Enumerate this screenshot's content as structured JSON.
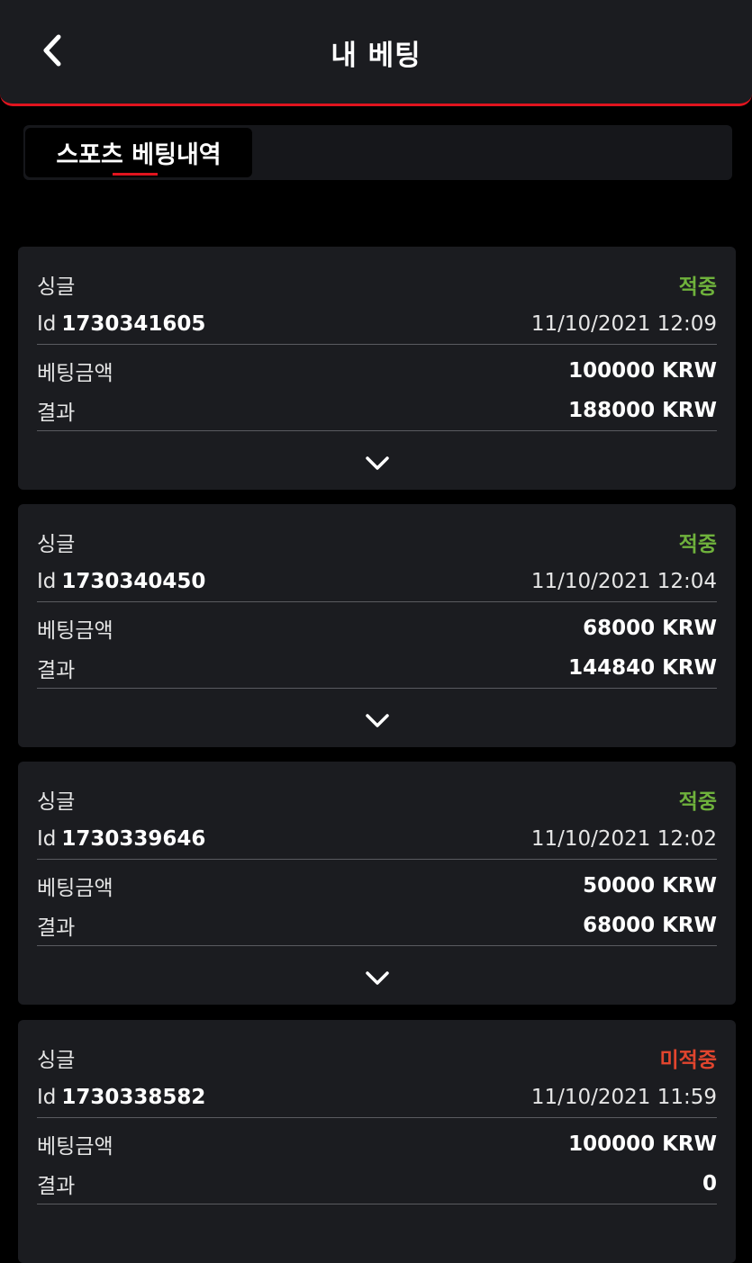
{
  "header": {
    "title": "내 베팅",
    "back_icon": "chevron-left-icon"
  },
  "tabs": [
    {
      "label": "스포츠 베팅내역",
      "active": true
    }
  ],
  "colors": {
    "accent": "#e0141e",
    "win": "#6fb23c",
    "lose": "#e2452e",
    "card": "#1b1c20"
  },
  "bets": [
    {
      "type": "싱글",
      "status": "적중",
      "status_kind": "win",
      "id_label": "Id",
      "id": "1730341605",
      "datetime": "11/10/2021 12:09",
      "stake_label": "베팅금액",
      "stake": "100000 KRW",
      "result_label": "결과",
      "result": "188000 KRW"
    },
    {
      "type": "싱글",
      "status": "적중",
      "status_kind": "win",
      "id_label": "Id",
      "id": "1730340450",
      "datetime": "11/10/2021 12:04",
      "stake_label": "베팅금액",
      "stake": "68000 KRW",
      "result_label": "결과",
      "result": "144840 KRW"
    },
    {
      "type": "싱글",
      "status": "적중",
      "status_kind": "win",
      "id_label": "Id",
      "id": "1730339646",
      "datetime": "11/10/2021 12:02",
      "stake_label": "베팅금액",
      "stake": "50000 KRW",
      "result_label": "결과",
      "result": "68000 KRW"
    },
    {
      "type": "싱글",
      "status": "미적중",
      "status_kind": "lose",
      "id_label": "Id",
      "id": "1730338582",
      "datetime": "11/10/2021 11:59",
      "stake_label": "베팅금액",
      "stake": "100000 KRW",
      "result_label": "결과",
      "result": "0"
    }
  ]
}
